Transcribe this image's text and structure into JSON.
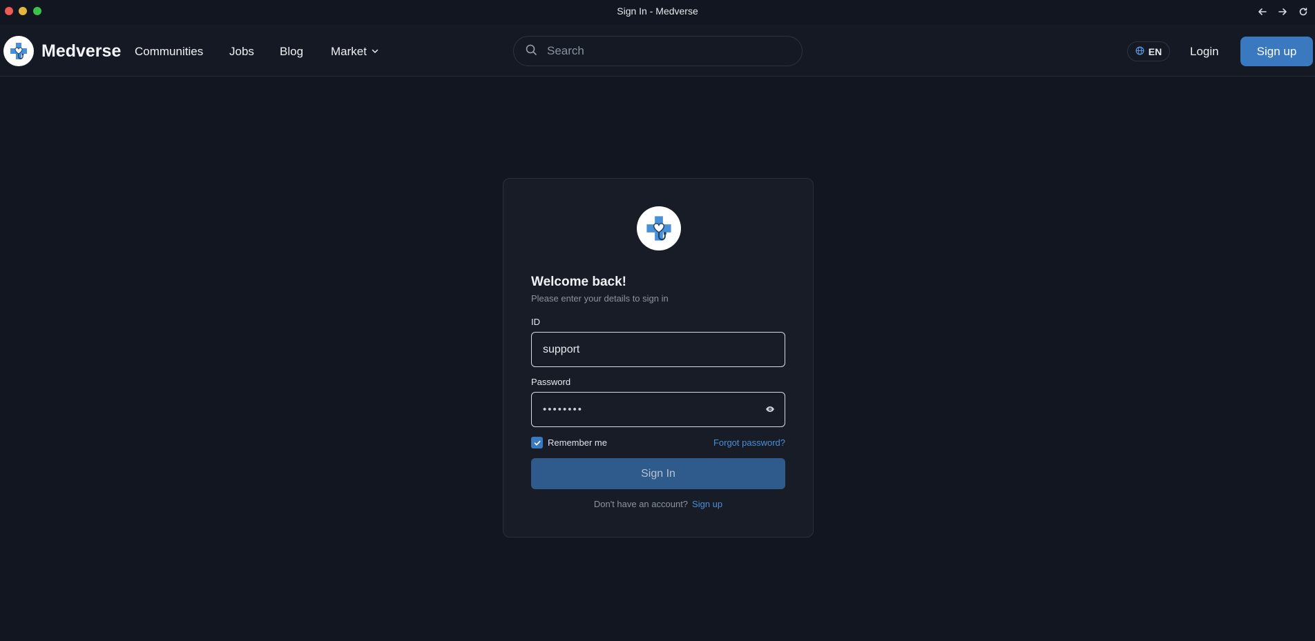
{
  "window": {
    "title": "Sign In - Medverse"
  },
  "header": {
    "brand": "Medverse",
    "nav": {
      "communities": "Communities",
      "jobs": "Jobs",
      "blog": "Blog",
      "market": "Market"
    },
    "search": {
      "placeholder": "Search"
    },
    "language": "EN",
    "login": "Login",
    "signup": "Sign up"
  },
  "signin_card": {
    "title": "Welcome back!",
    "subtitle": "Please enter your details to sign in",
    "id_label": "ID",
    "id_value": "support",
    "password_label": "Password",
    "password_masked": "••••••••",
    "remember_me": "Remember me",
    "remember_checked": true,
    "forgot_password": "Forgot password?",
    "submit": "Sign In",
    "no_account_text": "Don't have an account?",
    "signup_link": "Sign up"
  },
  "colors": {
    "background": "#121620",
    "accent": "#3a78c0",
    "link": "#4a8fd8"
  },
  "icons": [
    "close-dot",
    "minimize-dot",
    "maximize-dot",
    "arrow-left-icon",
    "arrow-right-icon",
    "reload-icon",
    "medverse-logo-icon",
    "chevron-down-icon",
    "search-icon",
    "globe-icon",
    "eye-icon",
    "checkmark-icon"
  ]
}
